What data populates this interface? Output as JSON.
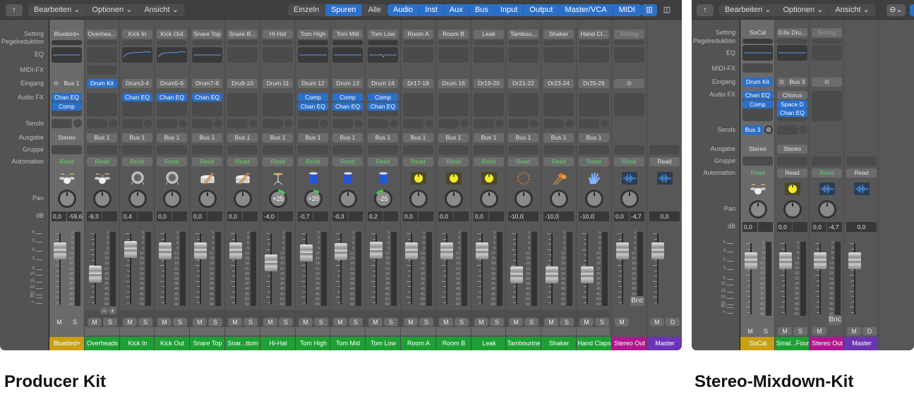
{
  "colors": {
    "blue": "#2b6fc8",
    "gold": "#c9a012",
    "green": "#1e9f34",
    "magenta": "#b2178f",
    "purple": "#6b35b5"
  },
  "row_labels_left": [
    "Setting",
    "Pegelreduktion",
    "EQ",
    "MIDI-FX",
    "Eingang",
    "Audio FX",
    "Sends",
    "Ausgabe",
    "Gruppe",
    "Automation",
    "Pan",
    "dB"
  ],
  "row_labels_right": [
    "Setting",
    "Pegelreduktion",
    "EQ",
    "MIDI-FX",
    "Eingang",
    "Audio FX",
    "Sends",
    "Ausgabe",
    "Gruppe",
    "Automation",
    "Pan",
    "dB"
  ],
  "toolbar_left": {
    "menus": [
      "Bearbeiten",
      "Optionen",
      "Ansicht"
    ],
    "view_modes": [
      "Einzeln",
      "Spuren",
      "Alle"
    ],
    "view_selected": "Spuren",
    "filters": [
      "Audio",
      "Inst",
      "Aux",
      "Bus",
      "Input",
      "Output",
      "Master/VCA",
      "MIDI"
    ]
  },
  "toolbar_right": {
    "menus": [
      "Bearbeiten",
      "Optionen",
      "Ansicht"
    ]
  },
  "fader_scale": [
    "6",
    "3",
    "0",
    "3",
    "6",
    "10",
    "15",
    "20",
    "30",
    "40",
    "∞"
  ],
  "meter_scale": [
    "0",
    "3",
    "6",
    "9",
    "12",
    "15",
    "18",
    "21",
    "24",
    "30",
    "35",
    "40",
    "45",
    "50",
    "60"
  ],
  "captions": {
    "left": "Producer Kit",
    "right": "Stereo-Mixdown-Kit"
  },
  "left": {
    "strips": [
      {
        "name": "Bluebird+",
        "color": "#c9a012",
        "sel": true,
        "setting": "Bluebird+",
        "peg": true,
        "eq": "flat",
        "input": "Bus 1",
        "link": true,
        "fx": [
          {
            "label": "Chan EQ",
            "on": true
          },
          {
            "label": "Comp",
            "on": true
          }
        ],
        "send": true,
        "output": "Stereo",
        "auto": "Read",
        "auto_green": true,
        "icon": "drumkit",
        "pan": 0,
        "db": "0,0",
        "peak": "-59,6",
        "fader": 0,
        "ms": [
          "M",
          "S"
        ]
      },
      {
        "name": "Overheads",
        "color": "#1e9f34",
        "setting": "Overhea...",
        "midifx": true,
        "input": "Drum Kit",
        "input_blue": true,
        "fx": [],
        "send": true,
        "output": "Bus 1",
        "auto": "Read",
        "auto_green": true,
        "icon": "drumkit",
        "pan": 0,
        "db": "-9,3",
        "peak": "",
        "fader": -9.3,
        "pm": [
          "−",
          "+"
        ],
        "ms": [
          "M",
          "S"
        ]
      },
      {
        "name": "Kick In",
        "color": "#1e9f34",
        "setting": "Kick In",
        "eq": "curve",
        "input": "Drum3-4",
        "fx": [
          {
            "label": "Chan EQ",
            "on": true
          }
        ],
        "send": true,
        "output": "Bus 1",
        "auto": "Read",
        "auto_green": true,
        "icon": "kick",
        "pan": 0,
        "db": "0,4",
        "peak": "",
        "fader": 0.4,
        "ms": [
          "M",
          "S"
        ]
      },
      {
        "name": "Kick Out",
        "color": "#1e9f34",
        "setting": "Kick Out",
        "eq": "curve",
        "input": "Drum5-6",
        "fx": [
          {
            "label": "Chan EQ",
            "on": true
          }
        ],
        "send": true,
        "output": "Bus 1",
        "auto": "Read",
        "auto_green": true,
        "icon": "kick",
        "pan": 0,
        "db": "0,0",
        "peak": "",
        "fader": 0,
        "ms": [
          "M",
          "S"
        ]
      },
      {
        "name": "Snare Top",
        "color": "#1e9f34",
        "setting": "Snare Top",
        "eq": "flat",
        "input": "Drum7-8",
        "fx": [
          {
            "label": "Chan EQ",
            "on": true
          }
        ],
        "send": true,
        "output": "Bus 1",
        "auto": "Read",
        "auto_green": true,
        "icon": "snare",
        "pan": 0,
        "db": "0,0",
        "peak": "",
        "fader": 0,
        "ms": [
          "M",
          "S"
        ]
      },
      {
        "name": "Snar...ttom",
        "color": "#1e9f34",
        "setting": "Snare B...",
        "input": "Dru9-10",
        "fx": [],
        "send": true,
        "output": "Bus 1",
        "auto": "Read",
        "auto_green": true,
        "icon": "snare",
        "pan": 0,
        "db": "0,0",
        "peak": "",
        "fader": 0,
        "ms": [
          "M",
          "S"
        ]
      },
      {
        "name": "Hi-Hat",
        "color": "#1e9f34",
        "setting": "Hi Hat",
        "input": "Drum 11",
        "fx": [],
        "send": true,
        "output": "Bus 1",
        "auto": "Read",
        "auto_green": true,
        "icon": "hihat",
        "pan": 25,
        "pan_label": "+25",
        "db": "-4,0",
        "peak": "",
        "fader": -4,
        "ms": [
          "M",
          "S"
        ]
      },
      {
        "name": "Tom High",
        "color": "#1e9f34",
        "setting": "Tom High",
        "peg": true,
        "eq": "flat",
        "input": "Drum 12",
        "fx": [
          {
            "label": "Comp",
            "on": true
          },
          {
            "label": "Chan EQ",
            "on": true
          }
        ],
        "send": true,
        "output": "Bus 1",
        "auto": "Read",
        "auto_green": true,
        "icon": "tom",
        "pan": 20,
        "pan_label": "+20",
        "db": "-0,7",
        "peak": "",
        "fader": -0.7,
        "ms": [
          "M",
          "S"
        ]
      },
      {
        "name": "Tom Mid",
        "color": "#1e9f34",
        "setting": "Tom Mid",
        "peg": true,
        "eq": "flat",
        "input": "Drum 13",
        "fx": [
          {
            "label": "Comp",
            "on": true
          },
          {
            "label": "Chan EQ",
            "on": true
          }
        ],
        "send": true,
        "output": "Bus 1",
        "auto": "Read",
        "auto_green": true,
        "icon": "tom",
        "pan": 0,
        "db": "-0,3",
        "peak": "",
        "fader": -0.3,
        "ms": [
          "M",
          "S"
        ]
      },
      {
        "name": "Tom Low",
        "color": "#1e9f34",
        "setting": "Tom Low",
        "peg": true,
        "eq": "dip",
        "input": "Drum 14",
        "fx": [
          {
            "label": "Comp",
            "on": true
          },
          {
            "label": "Chan EQ",
            "on": true
          }
        ],
        "send": true,
        "output": "Bus 1",
        "auto": "Read",
        "auto_green": true,
        "icon": "tom",
        "pan": -25,
        "pan_label": "-25",
        "db": "0,2",
        "peak": "",
        "fader": 0.2,
        "ms": [
          "M",
          "S"
        ]
      },
      {
        "name": "Room A",
        "color": "#1e9f34",
        "setting": "Room A",
        "input": "Dr17-18",
        "fx": [],
        "send": true,
        "output": "Bus 1",
        "auto": "Read",
        "auto_green": true,
        "icon": "knob",
        "pan": 0,
        "db": "0,0",
        "peak": "",
        "fader": 0,
        "ms": [
          "M",
          "S"
        ]
      },
      {
        "name": "Room B",
        "color": "#1e9f34",
        "setting": "Room B",
        "input": "Drum 16",
        "fx": [],
        "send": true,
        "output": "Bus 1",
        "auto": "Read",
        "auto_green": true,
        "icon": "knob",
        "pan": 0,
        "db": "0,0",
        "peak": "",
        "fader": 0,
        "ms": [
          "M",
          "S"
        ]
      },
      {
        "name": "Leak",
        "color": "#1e9f34",
        "setting": "Leak",
        "input": "Dr19-20",
        "fx": [],
        "send": true,
        "output": "Bus 1",
        "auto": "Read",
        "auto_green": true,
        "icon": "knob",
        "pan": 0,
        "db": "0,0",
        "peak": "",
        "fader": 0,
        "ms": [
          "M",
          "S"
        ]
      },
      {
        "name": "Tambourine",
        "color": "#1e9f34",
        "setting": "Tambou...",
        "input": "Dr21-22",
        "fx": [],
        "send": true,
        "output": "Bus 1",
        "auto": "Read",
        "auto_green": true,
        "icon": "tambourine",
        "pan": 0,
        "db": "-10,0",
        "peak": "",
        "fader": -10,
        "ms": [
          "M",
          "S"
        ]
      },
      {
        "name": "Shaker",
        "color": "#1e9f34",
        "setting": "Shaker",
        "input": "Dr23-24",
        "fx": [],
        "send": true,
        "output": "Bus 1",
        "auto": "Read",
        "auto_green": true,
        "icon": "maracas",
        "pan": 0,
        "db": "-10,0",
        "peak": "",
        "fader": -10,
        "ms": [
          "M",
          "S"
        ]
      },
      {
        "name": "Hand Claps",
        "color": "#1e9f34",
        "setting": "Hand Cl...",
        "input": "Dr25-26",
        "fx": [],
        "send": true,
        "output": "Bus 1",
        "auto": "Read",
        "auto_green": true,
        "icon": "hand",
        "pan": 0,
        "db": "-10,0",
        "peak": "",
        "fader": -10,
        "ms": [
          "M",
          "S"
        ]
      },
      {
        "name": "Stereo Out",
        "color": "#b2178f",
        "setting": "Setting",
        "setting_dim": true,
        "input": "",
        "link": true,
        "fx": [],
        "auto": "Read",
        "auto_green": true,
        "icon": "wave",
        "pan": 0,
        "db": "0,0",
        "peak": "-4,7",
        "fader": 0,
        "ms": [
          "M"
        ],
        "bnc": "Bnc"
      },
      {
        "name": "Master",
        "color": "#6b35b5",
        "auto": "Read",
        "icon": "wave",
        "nopan": true,
        "db": "0,0",
        "single": true,
        "fader": 0,
        "nometer": true,
        "ms": [
          "M",
          "D"
        ]
      }
    ],
    "scroll_arrow": ">"
  },
  "right": {
    "strips": [
      {
        "name": "SoCal",
        "color": "#c9a012",
        "sel": true,
        "setting": "SoCal",
        "peg": true,
        "eq": "flat",
        "midifx": true,
        "input": "Drum Kit",
        "input_blue": true,
        "fx": [
          {
            "label": "Chan EQ",
            "on": true
          },
          {
            "label": "Comp",
            "on": true
          }
        ],
        "send_label": "Bus 3",
        "output": "Stereo",
        "auto": "Read",
        "auto_green": true,
        "icon": "drumkit",
        "pan": 0,
        "db": "0,0",
        "peak": "",
        "fader": 0,
        "ms": [
          "M",
          "S"
        ]
      },
      {
        "name": "Smal...Four",
        "color": "#1e9f34",
        "setting": "0.6s Dru...",
        "eq": "flat",
        "input": "Bus 3",
        "link": true,
        "fx": [
          {
            "label": "Chorus",
            "on": false
          },
          {
            "label": "Space D",
            "on": true
          },
          {
            "label": "Chan EQ",
            "on": true
          }
        ],
        "send": true,
        "output": "Stereo",
        "auto": "Read",
        "icon": "knob",
        "pan": 0,
        "db": "0,0",
        "peak": "",
        "fader": 0,
        "ms": [
          "M",
          "S"
        ]
      },
      {
        "name": "Stereo Out",
        "color": "#b2178f",
        "setting": "Setting",
        "setting_dim": true,
        "input": "",
        "link": true,
        "fx": [],
        "auto": "Read",
        "auto_green": true,
        "icon": "wave",
        "pan": 0,
        "db": "0,0",
        "peak": "-4,7",
        "fader": 0,
        "ms": [
          "M"
        ],
        "bnc": "Bnc"
      },
      {
        "name": "Master",
        "color": "#6b35b5",
        "auto": "Read",
        "icon": "wave",
        "nopan": true,
        "db": "0,0",
        "single": true,
        "fader": 0,
        "nometer": true,
        "ms": [
          "M",
          "D"
        ]
      }
    ]
  }
}
